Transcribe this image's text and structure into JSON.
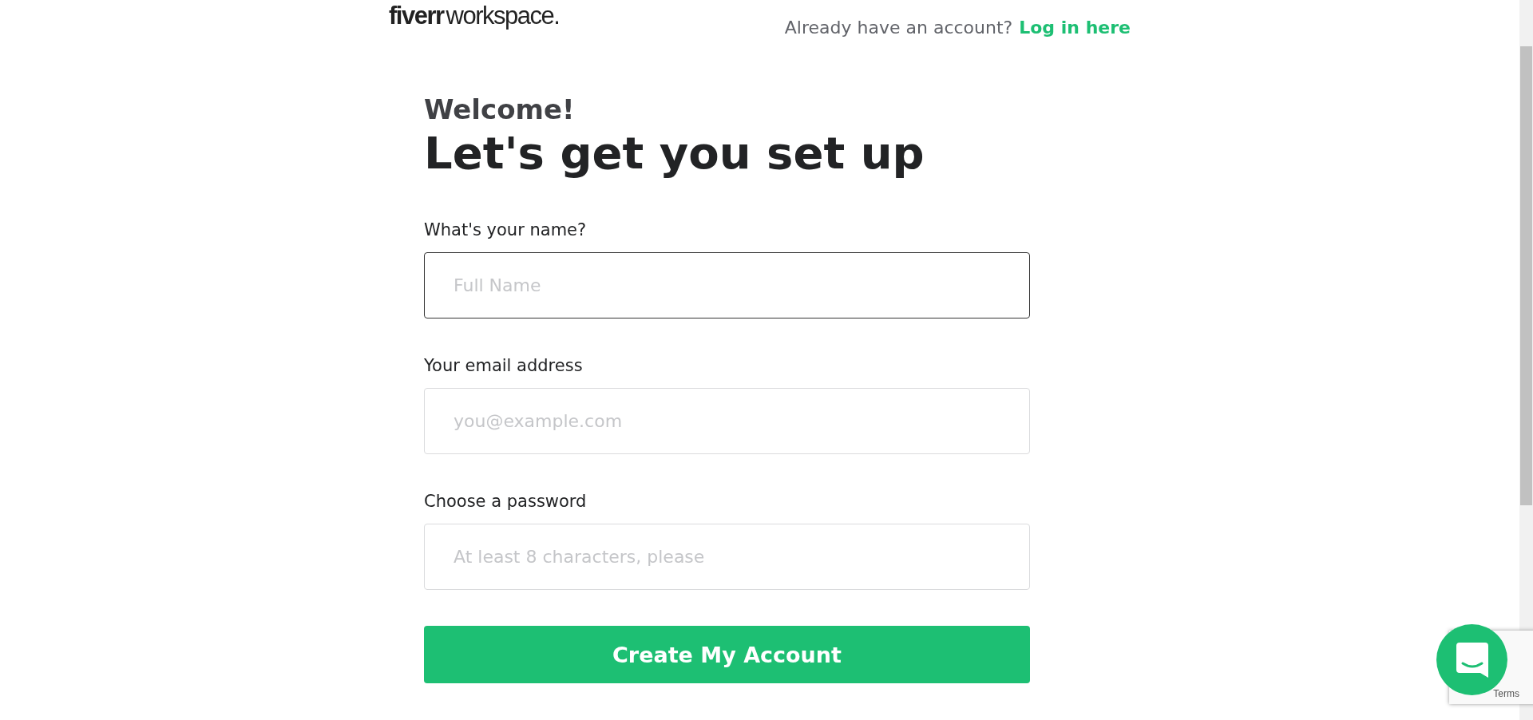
{
  "header": {
    "logo_bold": "fiverr",
    "logo_light": "workspace.",
    "prompt": "Already have an account?",
    "login_link": "Log in here"
  },
  "intro": {
    "greeting": "Welcome!",
    "title": "Let's get you set up"
  },
  "fields": [
    {
      "label": "What's your name?",
      "placeholder": "Full Name",
      "focused": true
    },
    {
      "label": "Your email address",
      "placeholder": "you@example.com",
      "focused": false
    },
    {
      "label": "Choose a password",
      "placeholder": "At least 8 characters, please",
      "focused": false
    }
  ],
  "submit_button": "Create My Account",
  "recaptcha": {
    "links": "Terms"
  }
}
